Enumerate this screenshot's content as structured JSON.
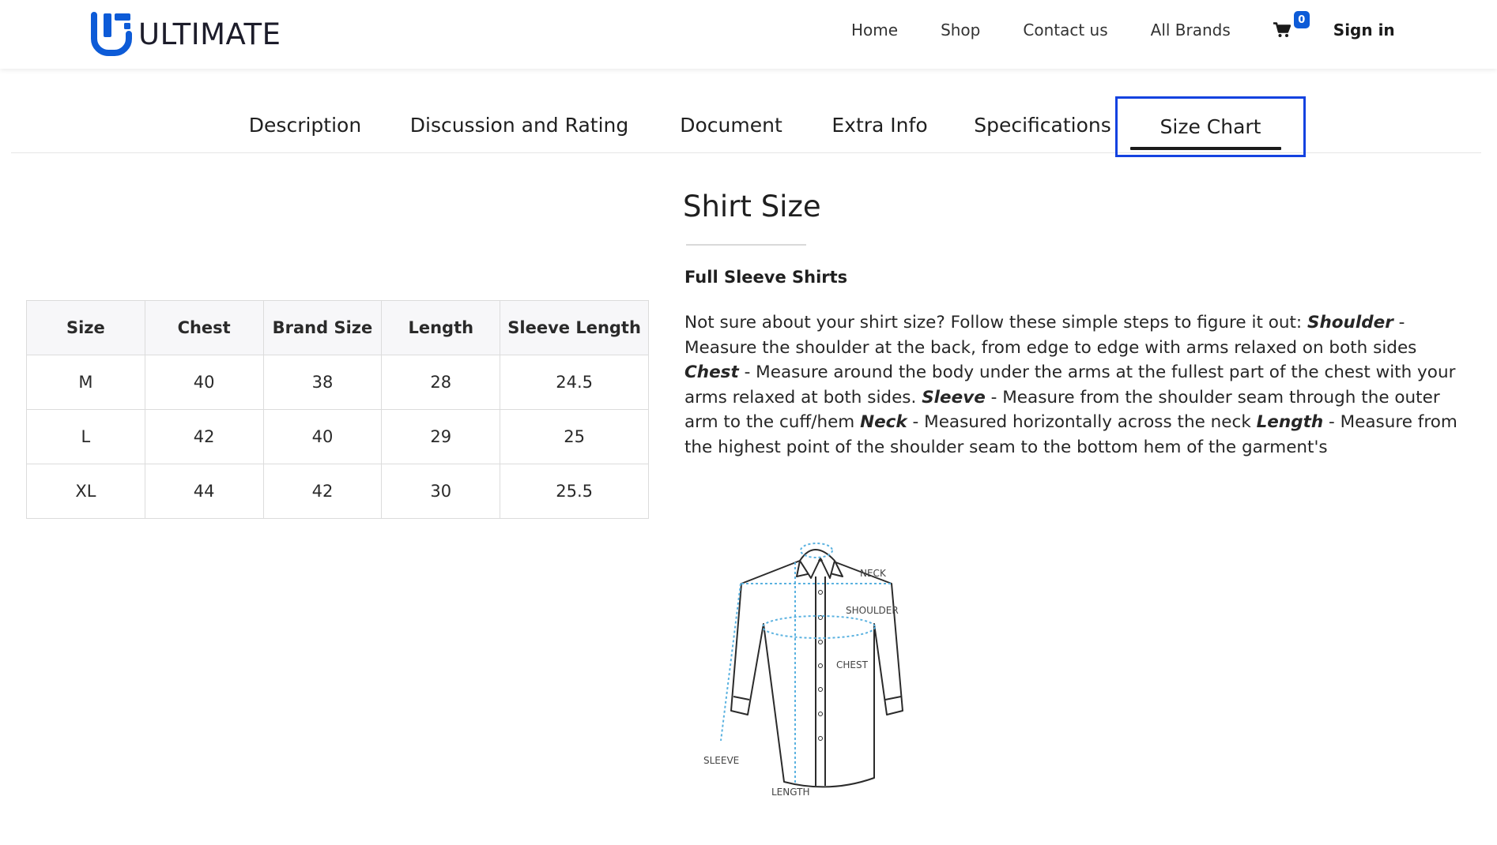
{
  "header": {
    "brand": "ULTIMATE",
    "nav": [
      "Home",
      "Shop",
      "Contact us",
      "All Brands"
    ],
    "cart_count": "0",
    "sign_in": "Sign in"
  },
  "tabs": [
    "Description",
    "Discussion and Rating",
    "Document",
    "Extra Info",
    "Specifications",
    "Size Chart"
  ],
  "active_tab": "Size Chart",
  "table": {
    "headers": [
      "Size",
      "Chest",
      "Brand Size",
      "Length",
      "Sleeve Length"
    ],
    "rows": [
      [
        "M",
        "40",
        "38",
        "28",
        "24.5"
      ],
      [
        "L",
        "42",
        "40",
        "29",
        "25"
      ],
      [
        "XL",
        "44",
        "42",
        "30",
        "25.5"
      ]
    ]
  },
  "content": {
    "title": "Shirt Size",
    "subheading": "Full Sleeve Shirts",
    "intro": "Not sure about your shirt size? Follow these simple steps to figure it out: ",
    "shoulder_label": "Shoulder",
    "shoulder_text": " - Measure the shoulder at the back, from edge to edge with arms relaxed on both sides ",
    "chest_label": "Chest",
    "chest_text": " - Measure around the body under the arms at the fullest part of the chest with your arms relaxed at both sides. ",
    "sleeve_label": "Sleeve",
    "sleeve_text": " - Measure from the shoulder seam through the outer arm to the cuff/hem ",
    "neck_label": "Neck",
    "neck_text": " - Measured horizontally across the neck ",
    "length_label": "Length",
    "length_text": " - Measure from the highest point of the shoulder seam to the bottom hem of the garment's"
  },
  "diagram_labels": {
    "neck": "NECK",
    "shoulder": "SHOULDER",
    "chest": "CHEST",
    "sleeve": "SLEEVE",
    "length": "LENGTH"
  },
  "colors": {
    "brand_blue": "#0d5bd7",
    "active_outline": "#1442e0",
    "measure_line": "#5bb2e0"
  }
}
